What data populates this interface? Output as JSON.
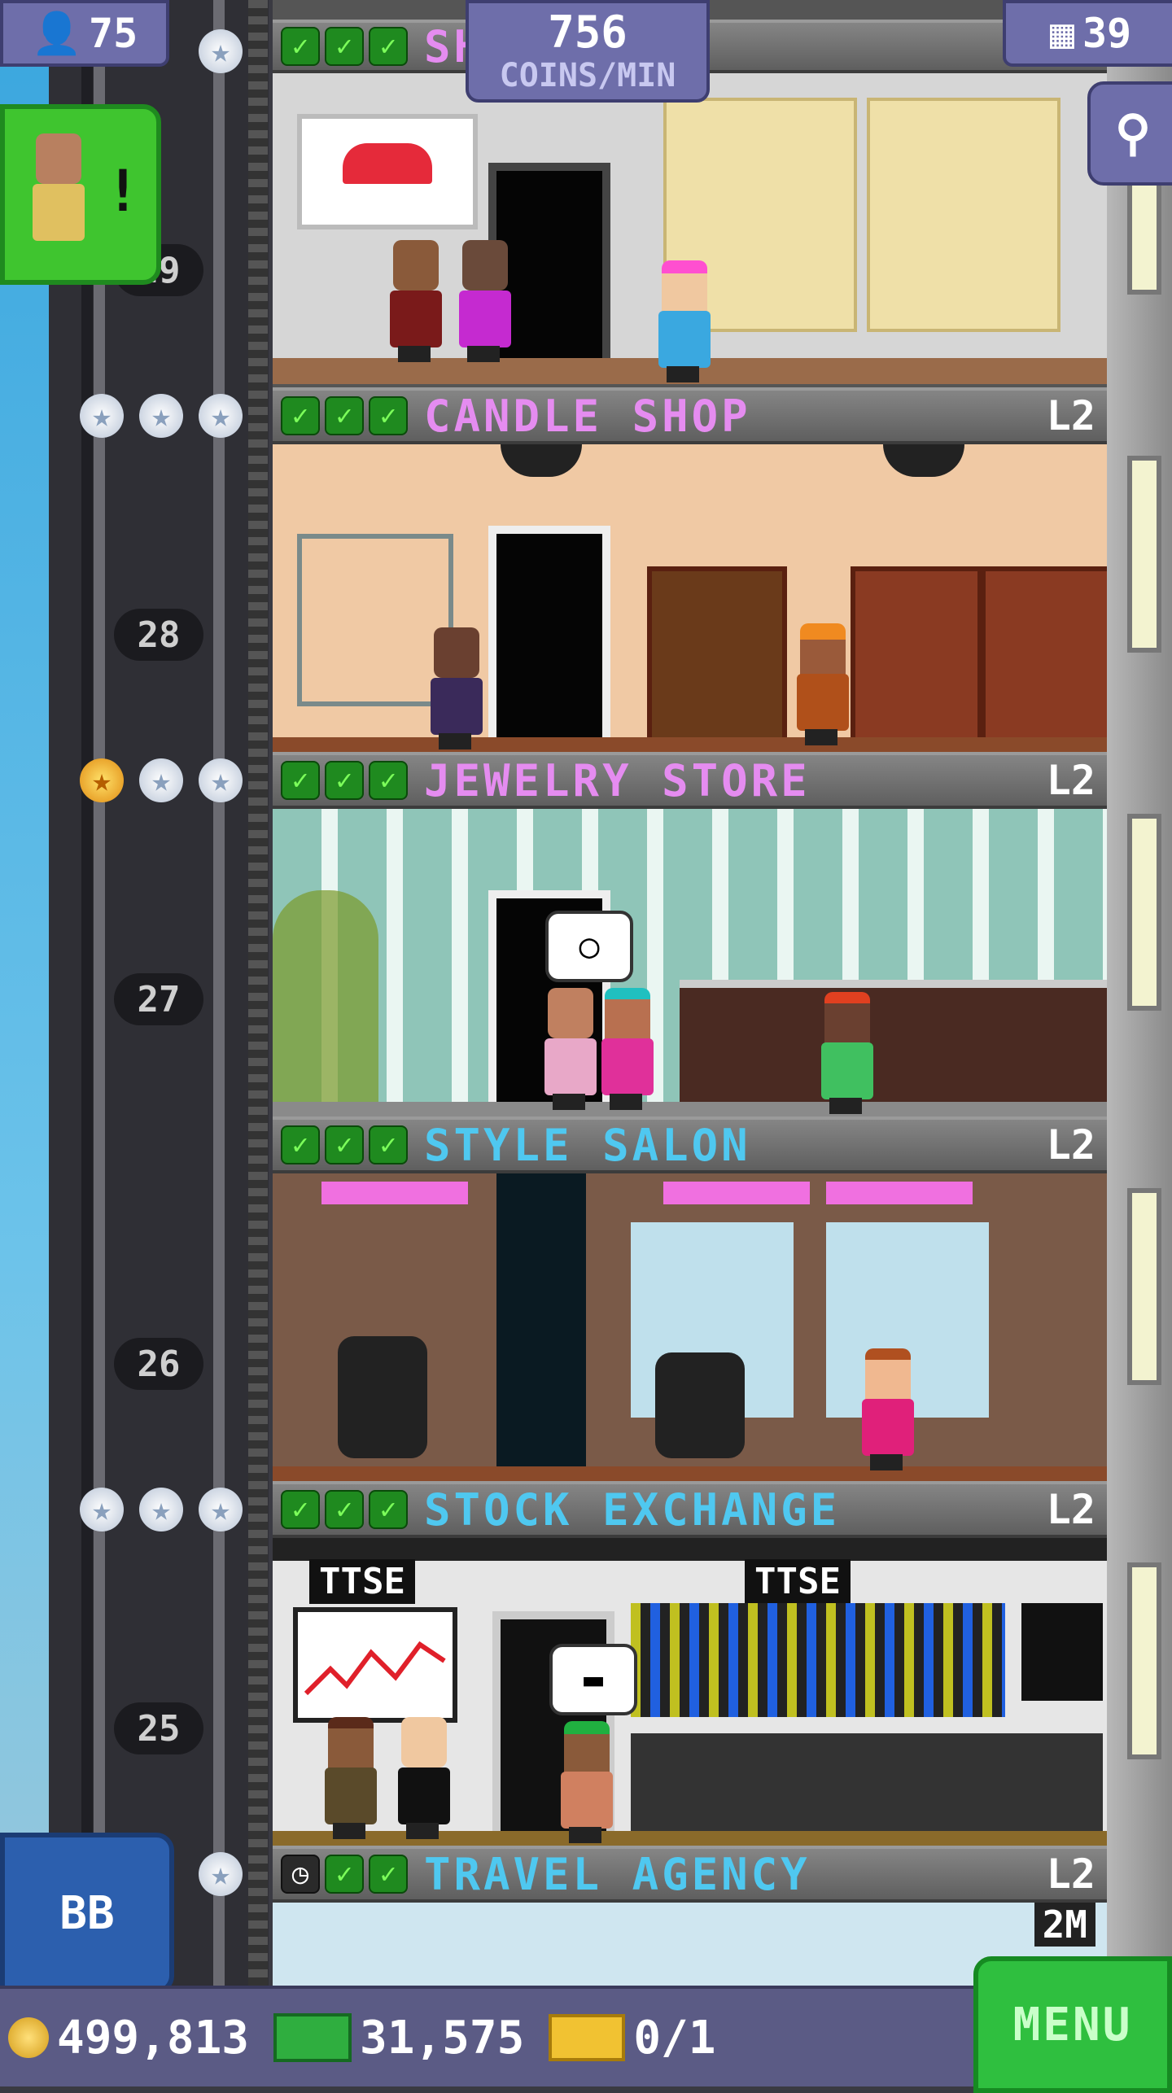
{
  "hud": {
    "population": "75",
    "coins_per_min": "756",
    "coins_per_min_label": "COINS/MIN",
    "floor_count": "39",
    "population_icon": "person-icon",
    "floors_icon": "building-icon",
    "search_icon": "magnifier-icon"
  },
  "top_floor_partial_name": "SH",
  "floors": [
    {
      "name": "CANDLE SHOP",
      "level": "L2",
      "color": "#e58cf0",
      "number": "28",
      "status": "checks"
    },
    {
      "name": "JEWELRY STORE",
      "level": "L2",
      "color": "#e58cf0",
      "number": "27",
      "status": "checks"
    },
    {
      "name": "STYLE SALON",
      "level": "L2",
      "color": "#4fc8f0",
      "number": "26",
      "status": "checks"
    },
    {
      "name": "STOCK EXCHANGE",
      "level": "L2",
      "color": "#4fc8f0",
      "number": "25",
      "status": "checks"
    },
    {
      "name": "TRAVEL AGENCY",
      "level": "L2",
      "color": "#4fc8f0",
      "number": "",
      "status": "timer",
      "timer_text": "2M"
    }
  ],
  "top_floor_number": "29",
  "signs": {
    "ttse_left": "TTSE",
    "ttse_right": "TTSE"
  },
  "buttons": {
    "bb_label": "BB",
    "menu_label": "MENU"
  },
  "bottom": {
    "coins": "499,813",
    "bux": "31,575",
    "tickets": "0/1"
  },
  "colors": {
    "hud_purple": "#6e6eaa",
    "menu_green": "#2fbf3f",
    "check_green": "#1f8a1f"
  }
}
